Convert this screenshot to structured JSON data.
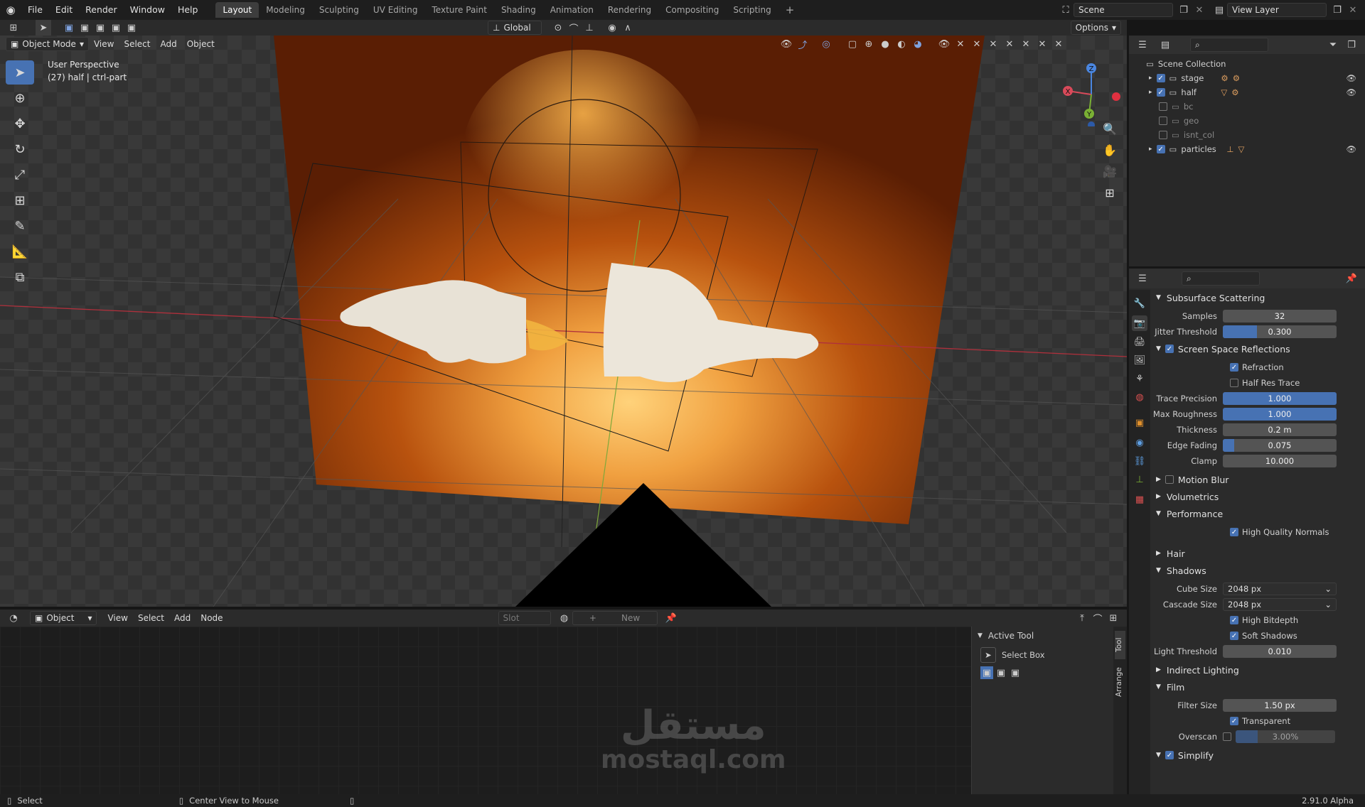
{
  "topbar": {
    "menus": [
      "File",
      "Edit",
      "Render",
      "Window",
      "Help"
    ],
    "workspaces": [
      "Layout",
      "Modeling",
      "Sculpting",
      "UV Editing",
      "Texture Paint",
      "Shading",
      "Animation",
      "Rendering",
      "Compositing",
      "Scripting"
    ],
    "active_workspace": "Layout",
    "scene": "Scene",
    "view_layer": "View Layer"
  },
  "viewport_header": {
    "mode": "Object Mode",
    "menus": [
      "View",
      "Select",
      "Add",
      "Object"
    ],
    "orientation": "Global",
    "options": "Options"
  },
  "viewport": {
    "perspective": "User Perspective",
    "object_info": "(27) half | ctrl-part",
    "gizmo_axes": {
      "x": "X",
      "y": "Y",
      "z": "Z"
    }
  },
  "outliner": {
    "root": "Scene Collection",
    "items": [
      {
        "name": "stage",
        "checked": true,
        "visible": true
      },
      {
        "name": "half",
        "checked": true,
        "visible": true
      },
      {
        "name": "bc",
        "checked": false,
        "visible": false
      },
      {
        "name": "geo",
        "checked": false,
        "visible": false
      },
      {
        "name": "isnt_col",
        "checked": false,
        "visible": false
      },
      {
        "name": "particles",
        "checked": true,
        "visible": true
      }
    ]
  },
  "properties": {
    "sss": {
      "title": "Subsurface Scattering",
      "samples_label": "Samples",
      "samples": "32",
      "jitter_label": "Jitter Threshold",
      "jitter": "0.300"
    },
    "ssr": {
      "title": "Screen Space Reflections",
      "refraction": "Refraction",
      "half_res": "Half Res Trace",
      "trace_precision_label": "Trace Precision",
      "trace_precision": "1.000",
      "max_roughness_label": "Max Roughness",
      "max_roughness": "1.000",
      "thickness_label": "Thickness",
      "thickness": "0.2 m",
      "edge_fading_label": "Edge Fading",
      "edge_fading": "0.075",
      "clamp_label": "Clamp",
      "clamp": "10.000"
    },
    "motion_blur": "Motion Blur",
    "volumetrics": "Volumetrics",
    "performance": {
      "title": "Performance",
      "hq_normals": "High Quality Normals"
    },
    "hair": "Hair",
    "shadows": {
      "title": "Shadows",
      "cube_size_label": "Cube Size",
      "cube_size": "2048 px",
      "cascade_size_label": "Cascade Size",
      "cascade_size": "2048 px",
      "high_bitdepth": "High Bitdepth",
      "soft_shadows": "Soft Shadows",
      "light_threshold_label": "Light Threshold",
      "light_threshold": "0.010"
    },
    "indirect_lighting": "Indirect Lighting",
    "film": {
      "title": "Film",
      "filter_size_label": "Filter Size",
      "filter_size": "1.50 px",
      "transparent": "Transparent",
      "overscan_label": "Overscan",
      "overscan": "3.00%"
    },
    "simplify": "Simplify"
  },
  "node_editor": {
    "type": "Object",
    "menus": [
      "View",
      "Select",
      "Add",
      "Node"
    ],
    "slot": "Slot",
    "new": "New"
  },
  "tool_panel": {
    "title": "Active Tool",
    "tool": "Select Box",
    "tab_tool": "Tool",
    "tab_arrange": "Arrange"
  },
  "watermark": {
    "arabic": "مستقل",
    "latin": "mostaql.com"
  },
  "statusbar": {
    "select": "Select",
    "center": "Center View to Mouse",
    "version": "2.91.0 Alpha"
  },
  "colors": {
    "accent": "#4772b3",
    "backdrop": "#c55a0e"
  }
}
